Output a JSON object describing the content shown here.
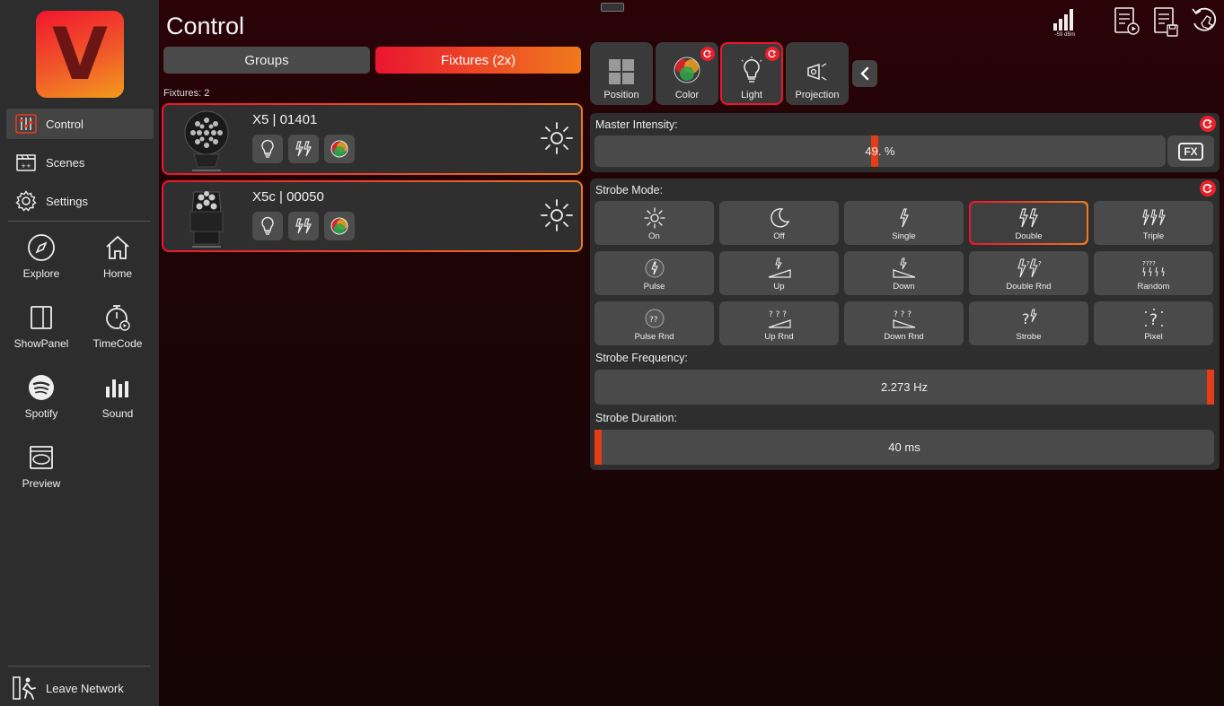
{
  "app": {
    "logo_letter": "V",
    "title": "Control",
    "accent_color": "#ea1530",
    "accent_color_2": "#f07a1c"
  },
  "sidebar": {
    "nav": [
      {
        "label": "Control",
        "icon": "control-sliders-icon",
        "active": true
      },
      {
        "label": "Scenes",
        "icon": "scenes-clapper-icon",
        "active": false
      },
      {
        "label": "Settings",
        "icon": "gear-icon",
        "active": false
      }
    ],
    "tiles": [
      {
        "label": "Explore",
        "icon": "compass-icon"
      },
      {
        "label": "Home",
        "icon": "home-icon"
      },
      {
        "label": "ShowPanel",
        "icon": "panel-icon"
      },
      {
        "label": "TimeCode",
        "icon": "stopwatch-icon"
      },
      {
        "label": "Spotify",
        "icon": "spotify-icon"
      },
      {
        "label": "Sound",
        "icon": "sound-bars-icon"
      },
      {
        "label": "Preview",
        "icon": "preview-icon"
      }
    ],
    "leave_label": "Leave Network"
  },
  "header": {
    "signal_text": "-59 dBm"
  },
  "fixtures_panel": {
    "groups_label": "Groups",
    "fixtures_tab_label": "Fixtures (2x)",
    "count_label": "Fixtures: 2",
    "fixtures": [
      {
        "name": "X5 | 01401"
      },
      {
        "name": "X5c | 00050"
      }
    ]
  },
  "control_tabs": [
    {
      "label": "Position",
      "icon": "position-grid-icon",
      "badge": false,
      "selected": false
    },
    {
      "label": "Color",
      "icon": "color-circles-icon",
      "badge": true,
      "selected": false
    },
    {
      "label": "Light",
      "icon": "bulb-icon",
      "badge": true,
      "selected": true
    },
    {
      "label": "Projection",
      "icon": "projector-icon",
      "badge": false,
      "selected": false
    }
  ],
  "master": {
    "label": "Master Intensity:",
    "value_text": "49.  %",
    "level": 0.49
  },
  "strobe": {
    "label": "Strobe Mode:",
    "modes": [
      {
        "label": "On",
        "icon": "sun-icon"
      },
      {
        "label": "Off",
        "icon": "moon-icon"
      },
      {
        "label": "Single",
        "icon": "single-bolt-icon"
      },
      {
        "label": "Double",
        "icon": "double-bolt-icon",
        "selected": true
      },
      {
        "label": "Triple",
        "icon": "triple-bolt-icon"
      },
      {
        "label": "Pulse",
        "icon": "pulse-icon"
      },
      {
        "label": "Up",
        "icon": "ramp-up-icon"
      },
      {
        "label": "Down",
        "icon": "ramp-down-icon"
      },
      {
        "label": "Double Rnd",
        "icon": "double-rnd-icon"
      },
      {
        "label": "Random",
        "icon": "random-icon"
      },
      {
        "label": "Pulse Rnd",
        "icon": "pulse-rnd-icon"
      },
      {
        "label": "Up Rnd",
        "icon": "up-rnd-icon"
      },
      {
        "label": "Down Rnd",
        "icon": "down-rnd-icon"
      },
      {
        "label": "Strobe",
        "icon": "strobe-rnd-icon"
      },
      {
        "label": "Pixel",
        "icon": "pixel-rnd-icon"
      }
    ],
    "frequency": {
      "label": "Strobe Frequency:",
      "value_text": "2.273 Hz",
      "level": 1.0
    },
    "duration": {
      "label": "Strobe Duration:",
      "value_text": "40 ms",
      "level": 0.0
    }
  },
  "fx_label": "FX"
}
